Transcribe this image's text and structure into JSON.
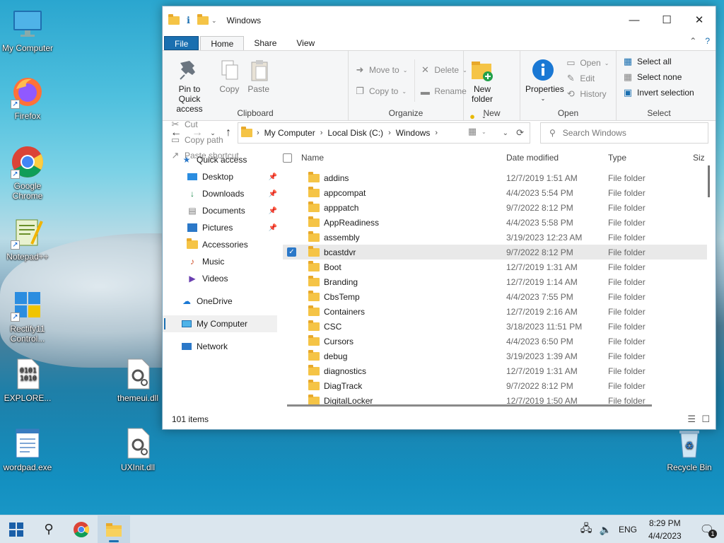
{
  "desktop": {
    "icons": [
      {
        "label": "My Computer",
        "icon": "monitor-icon"
      },
      {
        "label": "Firefox",
        "icon": "firefox-icon"
      },
      {
        "label": "Google Chrome",
        "icon": "chrome-icon"
      },
      {
        "label": "Notepad++",
        "icon": "notepadpp-icon"
      },
      {
        "label": "Rectify11 Control...",
        "icon": "windows-logo-icon"
      },
      {
        "label": "EXPLORE...",
        "icon": "binary-file-icon"
      },
      {
        "label": "wordpad.exe",
        "icon": "wordpad-icon"
      },
      {
        "label": "themeui.dll",
        "icon": "dll-file-icon"
      },
      {
        "label": "UXInit.dll",
        "icon": "dll-file-icon"
      },
      {
        "label": "Recycle Bin",
        "icon": "recycle-bin-icon"
      }
    ]
  },
  "window": {
    "title": "Windows",
    "controls": {
      "minimize": "—",
      "maximize": "☐",
      "close": "✕"
    }
  },
  "ribbon": {
    "tabs": [
      "File",
      "Home",
      "Share",
      "View"
    ],
    "active_tab": "Home",
    "clipboard": {
      "label": "Clipboard",
      "pin": "Pin to Quick access",
      "copy": "Copy",
      "paste": "Paste",
      "cut": "Cut",
      "copy_path": "Copy path",
      "paste_shortcut": "Paste shortcut"
    },
    "organize": {
      "label": "Organize",
      "move_to": "Move to",
      "copy_to": "Copy to",
      "delete": "Delete",
      "rename": "Rename"
    },
    "new": {
      "label": "New",
      "new_folder": "New folder"
    },
    "open": {
      "label": "Open",
      "properties": "Properties",
      "open": "Open",
      "edit": "Edit",
      "history": "History"
    },
    "select": {
      "label": "Select",
      "select_all": "Select all",
      "select_none": "Select none",
      "invert": "Invert selection"
    }
  },
  "address": {
    "crumbs": [
      "My Computer",
      "Local Disk (C:)",
      "Windows"
    ],
    "search_placeholder": "Search Windows"
  },
  "navpane": {
    "items": [
      {
        "label": "Quick access",
        "icon": "star-icon",
        "pinned": false
      },
      {
        "label": "Desktop",
        "icon": "desktop-icon",
        "pinned": true
      },
      {
        "label": "Downloads",
        "icon": "download-icon",
        "pinned": true
      },
      {
        "label": "Documents",
        "icon": "document-icon",
        "pinned": true
      },
      {
        "label": "Pictures",
        "icon": "picture-icon",
        "pinned": true
      },
      {
        "label": "Accessories",
        "icon": "folder-icon",
        "pinned": false
      },
      {
        "label": "Music",
        "icon": "music-icon",
        "pinned": false
      },
      {
        "label": "Videos",
        "icon": "video-icon",
        "pinned": false
      },
      {
        "label": "OneDrive",
        "icon": "cloud-icon",
        "pinned": false
      },
      {
        "label": "My Computer",
        "icon": "monitor-icon",
        "pinned": false
      },
      {
        "label": "Network",
        "icon": "network-icon",
        "pinned": false
      }
    ],
    "selected": "My Computer"
  },
  "filelist": {
    "columns": {
      "name": "Name",
      "date": "Date modified",
      "type": "Type",
      "size": "Siz"
    },
    "rows": [
      {
        "name": "addins",
        "date": "12/7/2019 1:51 AM",
        "type": "File folder"
      },
      {
        "name": "appcompat",
        "date": "4/4/2023 5:54 PM",
        "type": "File folder"
      },
      {
        "name": "apppatch",
        "date": "9/7/2022 8:12 PM",
        "type": "File folder"
      },
      {
        "name": "AppReadiness",
        "date": "4/4/2023 5:58 PM",
        "type": "File folder"
      },
      {
        "name": "assembly",
        "date": "3/19/2023 12:23 AM",
        "type": "File folder"
      },
      {
        "name": "bcastdvr",
        "date": "9/7/2022 8:12 PM",
        "type": "File folder"
      },
      {
        "name": "Boot",
        "date": "12/7/2019 1:31 AM",
        "type": "File folder"
      },
      {
        "name": "Branding",
        "date": "12/7/2019 1:14 AM",
        "type": "File folder"
      },
      {
        "name": "CbsTemp",
        "date": "4/4/2023 7:55 PM",
        "type": "File folder"
      },
      {
        "name": "Containers",
        "date": "12/7/2019 2:16 AM",
        "type": "File folder"
      },
      {
        "name": "CSC",
        "date": "3/18/2023 11:51 PM",
        "type": "File folder"
      },
      {
        "name": "Cursors",
        "date": "4/4/2023 6:50 PM",
        "type": "File folder"
      },
      {
        "name": "debug",
        "date": "3/19/2023 1:39 AM",
        "type": "File folder"
      },
      {
        "name": "diagnostics",
        "date": "12/7/2019 1:31 AM",
        "type": "File folder"
      },
      {
        "name": "DiagTrack",
        "date": "9/7/2022 8:12 PM",
        "type": "File folder"
      },
      {
        "name": "DigitalLocker",
        "date": "12/7/2019 1:50 AM",
        "type": "File folder"
      }
    ],
    "hovered_checked": "bcastdvr"
  },
  "status": {
    "item_count": "101 items"
  },
  "taskbar": {
    "language": "ENG",
    "time": "8:29 PM",
    "date": "4/4/2023",
    "notification_count": "1"
  }
}
